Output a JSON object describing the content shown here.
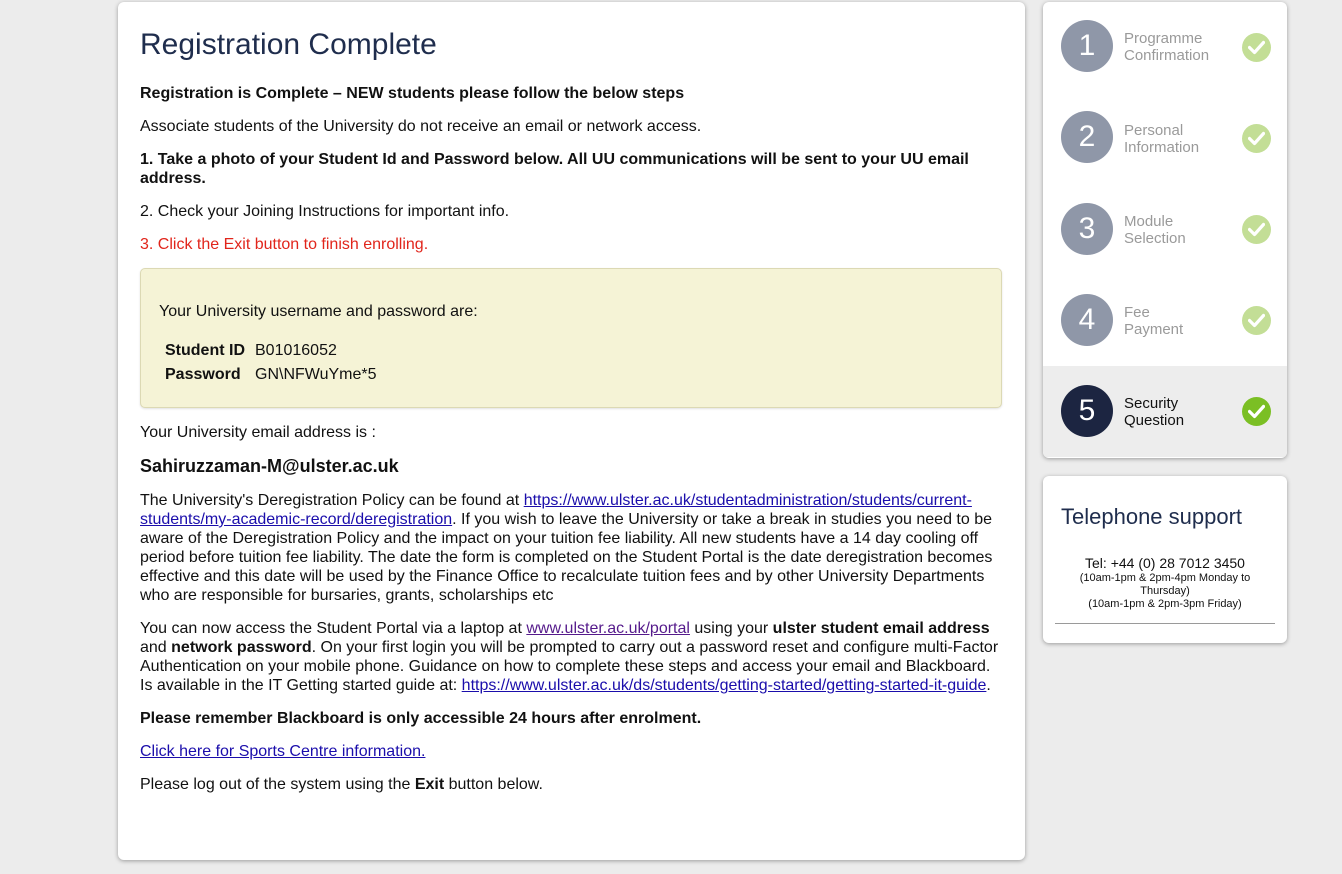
{
  "main": {
    "title": "Registration Complete",
    "heading": "Registration is Complete – NEW students please follow the below steps",
    "associate_note": "Associate students of the University do not receive an email or network access.",
    "step1": "1. Take a photo of your Student Id and Password below. All UU communications will be sent to your UU email address.",
    "step2": "2. Check your Joining Instructions for important info.",
    "step3": "3. Click the Exit button to finish enrolling.",
    "credentials": {
      "intro": "Your University username and password are:",
      "student_id_label": "Student ID",
      "student_id_value": "B01016052",
      "password_label": "Password",
      "password_value": "GN\\NFWuYme*5"
    },
    "email_intro": "Your University email address is :",
    "email": "Sahiruzzaman-M@ulster.ac.uk",
    "dereg": {
      "prefix": "The University's Deregistration Policy can be found at ",
      "link": "https://www.ulster.ac.uk/studentadministration/students/current-students/my-academic-record/deregistration",
      "suffix": ". If you wish to leave the University or take a break in studies you need to be aware of the Deregistration Policy and the impact on your tuition fee liability. All new students have a 14 day cooling off period before tuition fee liability. The date the form is completed on the Student Portal is the date deregistration becomes effective and this date will be used by the Finance Office to recalculate tuition fees and by other University Departments who are responsible for bursaries, grants, scholarships etc"
    },
    "portal": {
      "t1": "You can now access the Student Portal via a laptop at ",
      "link1": "www.ulster.ac.uk/portal",
      "t2": " using your ",
      "b1": "ulster student email address",
      "t3": " and ",
      "b2": "network password",
      "t4": ". On your first login you will be prompted to carry out a password reset and configure multi-Factor Authentication on your mobile phone. Guidance on how to complete these steps and access your email and Blackboard. Is available in the IT Getting started guide at: ",
      "link2": "https://www.ulster.ac.uk/ds/students/getting-started/getting-started-it-guide",
      "t5": "."
    },
    "blackboard_note": "Please remember Blackboard is only accessible 24 hours after enrolment.",
    "sports_link": "Click here for Sports Centre information.",
    "logout": {
      "t1": "Please log out of the system using the ",
      "bold": "Exit",
      "t2": " button below."
    }
  },
  "steps": [
    {
      "number": "1",
      "label_line1": "Programme",
      "label_line2": "Confirmation",
      "complete": true,
      "active": false
    },
    {
      "number": "2",
      "label_line1": "Personal",
      "label_line2": "Information",
      "complete": true,
      "active": false
    },
    {
      "number": "3",
      "label_line1": "Module",
      "label_line2": "Selection",
      "complete": true,
      "active": false
    },
    {
      "number": "4",
      "label_line1": "Fee",
      "label_line2": "Payment",
      "complete": true,
      "active": false
    },
    {
      "number": "5",
      "label_line1": "Security",
      "label_line2": "Question",
      "complete": true,
      "active": true
    }
  ],
  "support": {
    "title": "Telephone support",
    "tel": "Tel: +44 (0) 28 7012 3450",
    "hours1": "(10am-1pm & 2pm-4pm Monday to Thursday)",
    "hours2": "(10am-1pm & 2pm-3pm Friday)"
  },
  "colors": {
    "title": "#1f2d4d",
    "warning_red": "#e1251b",
    "check_done": "#c3de96",
    "check_active": "#7bbf24",
    "step_active": "#1c2541",
    "step_inactive": "#8f97a8"
  }
}
